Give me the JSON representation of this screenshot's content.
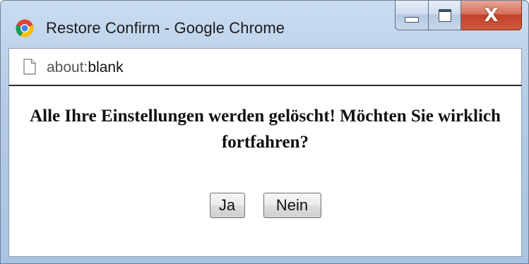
{
  "window": {
    "title": "Restore Confirm - Google Chrome",
    "app_icon": "chrome-icon",
    "controls": {
      "minimize_icon": "minimize-icon",
      "maximize_icon": "maximize-icon",
      "close_icon": "close-icon",
      "close_glyph": "X"
    }
  },
  "addressbar": {
    "page_icon": "page-icon",
    "url_scheme": "about:",
    "url_host": "blank"
  },
  "dialog": {
    "message": "Alle Ihre Einstellungen werden gelöscht! Möchten Sie wirklich fortfahren?",
    "yes_label": "Ja",
    "no_label": "Nein"
  },
  "colors": {
    "close_button": "#c2412a",
    "frame": "#b4cbe6"
  }
}
